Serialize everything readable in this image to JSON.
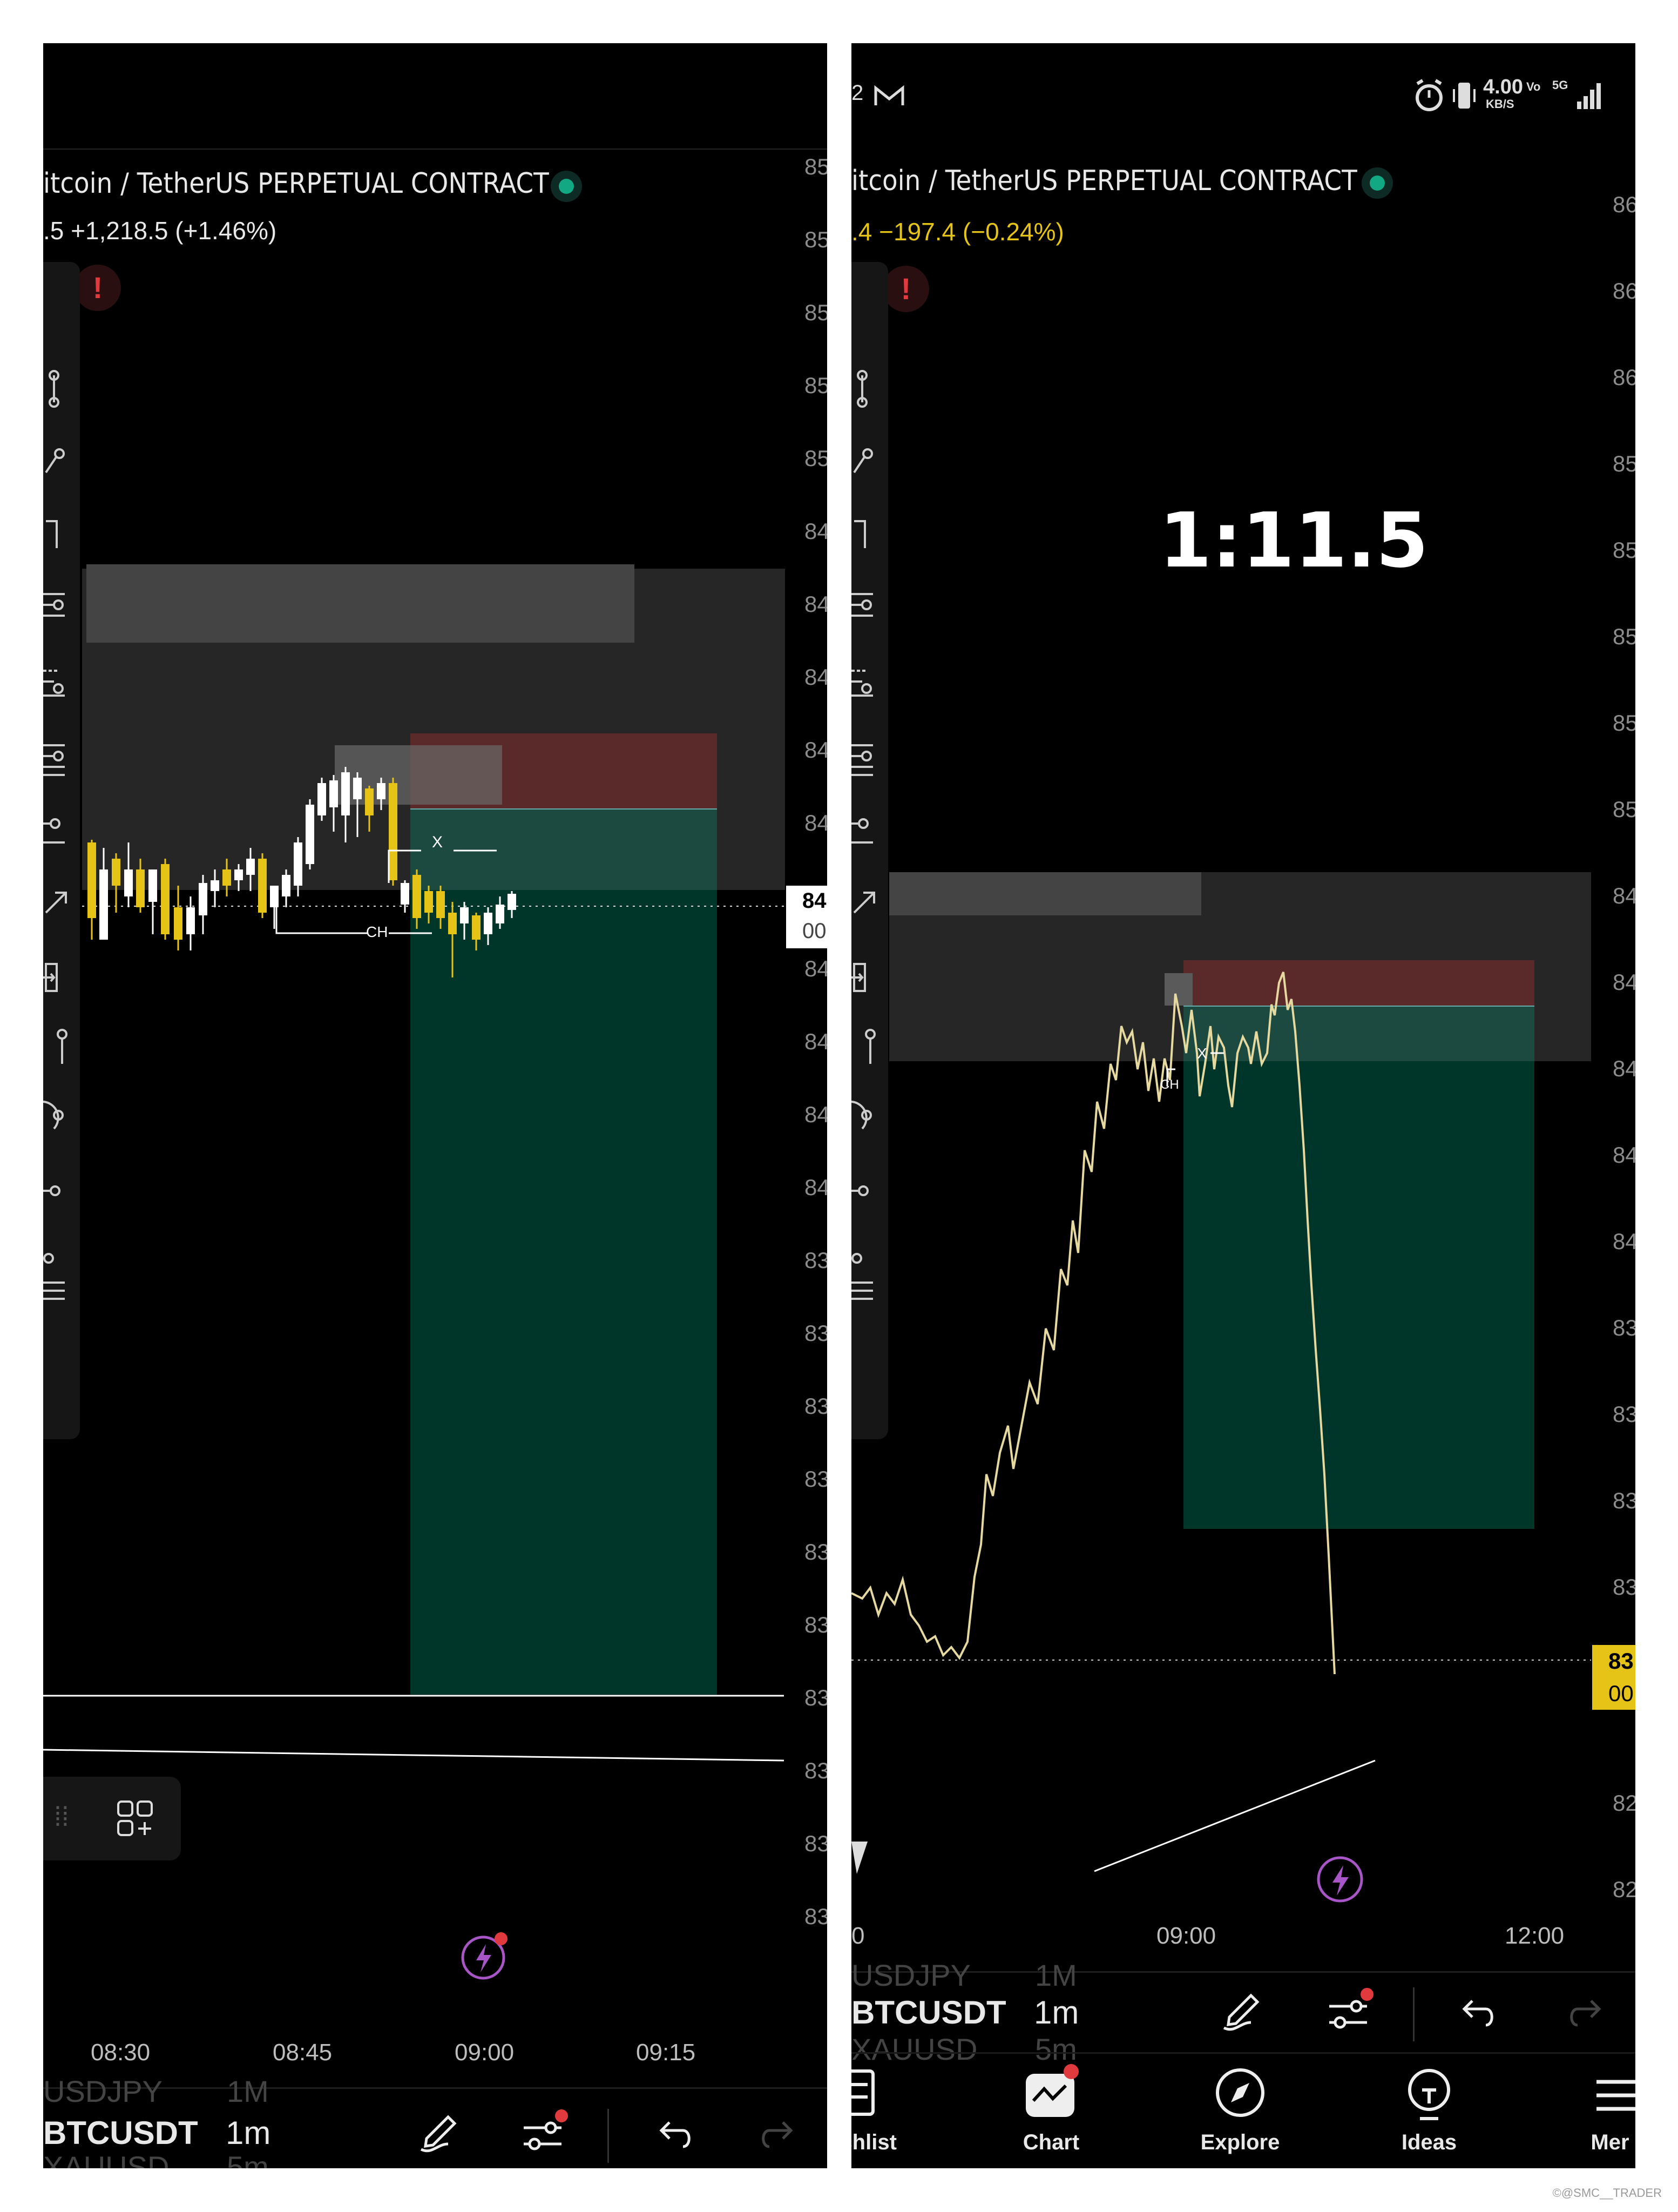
{
  "left": {
    "title": "itcoin / TetherUS PERPETUAL CONTRACT",
    "change": ".5  +1,218.5 (+1.46%)",
    "price_axis": [
      "85",
      "85",
      "85",
      "85",
      "85",
      "84",
      "84",
      "84",
      "84",
      "84",
      "84",
      "84",
      "84",
      "84",
      "83",
      "83",
      "83",
      "83",
      "83",
      "83",
      "83",
      "83",
      "83",
      "83"
    ],
    "current_price": [
      "84",
      "00"
    ],
    "labels": {
      "x": "X",
      "ch": "CH"
    },
    "time_axis": [
      "08:30",
      "08:45",
      "09:00",
      "09:15"
    ],
    "symbols": {
      "above": "USDJPY",
      "above_tf": "1M",
      "active": "BTCUSDT",
      "active_tf": "1m",
      "below": "XAUUSD",
      "below_tf": "5m"
    },
    "icons": [
      "brush-icon",
      "settings-icon",
      "undo-icon",
      "redo-icon",
      "flash-icon",
      "add-widget-icon"
    ]
  },
  "right": {
    "status": {
      "left_text": "2",
      "speed": "4.00",
      "speed_unit": "KB/S",
      "vo": "Vo",
      "g5": "5G"
    },
    "title": "itcoin / TetherUS PERPETUAL CONTRACT",
    "change": ".4  −197.4 (−0.24%)",
    "ratio": "1:11.5",
    "price_axis": [
      "86",
      "86",
      "86",
      "85",
      "85",
      "85",
      "85",
      "85",
      "84",
      "84",
      "84",
      "84",
      "84",
      "83",
      "83",
      "83",
      "83",
      "83",
      "82",
      "82"
    ],
    "current_price": [
      "83",
      "00"
    ],
    "labels": {
      "x": "X",
      "ch": "CH"
    },
    "time_axis": [
      "0",
      "09:00",
      "12:00"
    ],
    "symbols": {
      "above": "USDJPY",
      "above_tf": "1M",
      "active": "BTCUSDT",
      "active_tf": "1m",
      "below": "XAUUSD",
      "below_tf": "5m"
    },
    "nav": [
      {
        "label": "tchlist",
        "icon": "watchlist-icon"
      },
      {
        "label": "Chart",
        "icon": "chart-icon"
      },
      {
        "label": "Explore",
        "icon": "compass-icon"
      },
      {
        "label": "Ideas",
        "icon": "lightbulb-icon"
      },
      {
        "label": "Mer",
        "icon": "menu-icon"
      }
    ]
  },
  "watermark": "©@SMC__TRADER",
  "colors": {
    "profit": "#003629",
    "loss": "#5a2a2a",
    "candle_up": "#ffffff",
    "candle_down": "#e6c417",
    "accent_purple": "#a855c7"
  }
}
